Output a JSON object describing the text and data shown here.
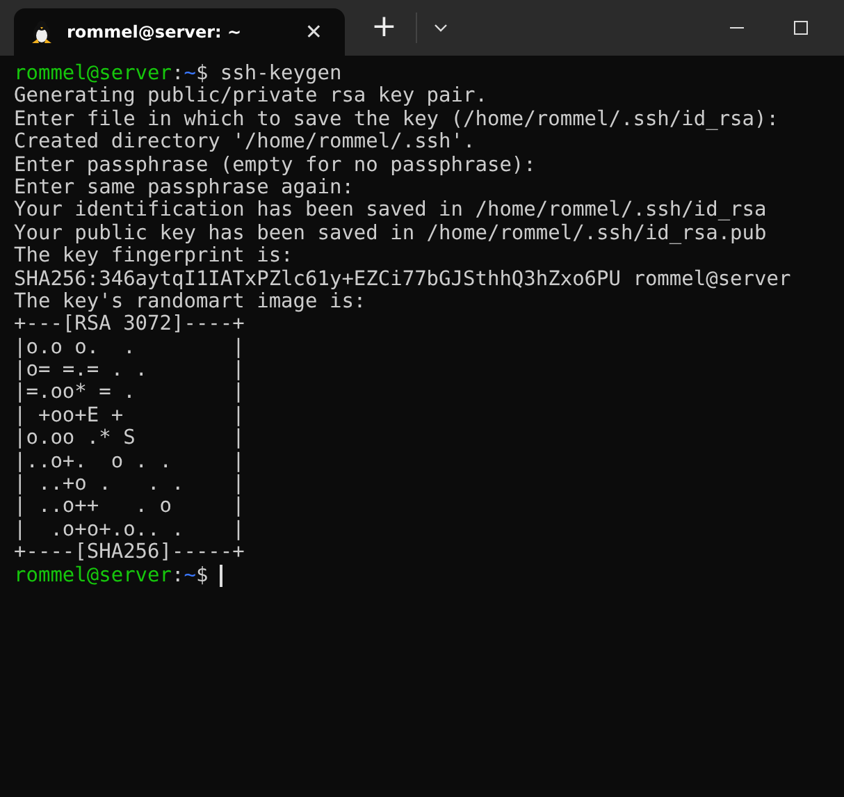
{
  "tab": {
    "title": "rommel@server: ~",
    "selected": true,
    "close": "✕"
  },
  "toolbar": {
    "new_tab": "+"
  },
  "lines": [
    {
      "kind": "prompt",
      "user_host": "rommel@server",
      "separator": ":",
      "path": "~",
      "symbol": "$",
      "command": "ssh-keygen",
      "cursor": false
    },
    {
      "kind": "output",
      "text": "Generating public/private rsa key pair."
    },
    {
      "kind": "output",
      "text": "Enter file in which to save the key (/home/rommel/.ssh/id_rsa):"
    },
    {
      "kind": "output",
      "text": "Created directory '/home/rommel/.ssh'."
    },
    {
      "kind": "output",
      "text": "Enter passphrase (empty for no passphrase):"
    },
    {
      "kind": "output",
      "text": "Enter same passphrase again:"
    },
    {
      "kind": "output",
      "text": "Your identification has been saved in /home/rommel/.ssh/id_rsa"
    },
    {
      "kind": "output",
      "text": "Your public key has been saved in /home/rommel/.ssh/id_rsa.pub"
    },
    {
      "kind": "output",
      "text": "The key fingerprint is:"
    },
    {
      "kind": "output",
      "text": "SHA256:346aytqI1IATxPZlc61y+EZCi77bGJSthhQ3hZxo6PU rommel@server"
    },
    {
      "kind": "output",
      "text": "The key's randomart image is:"
    },
    {
      "kind": "output",
      "text": "+---[RSA 3072]----+"
    },
    {
      "kind": "output",
      "text": "|o.o o.  .        |"
    },
    {
      "kind": "output",
      "text": "|o= =.= . .       |"
    },
    {
      "kind": "output",
      "text": "|=.oo* = .        |"
    },
    {
      "kind": "output",
      "text": "| +oo+E +         |"
    },
    {
      "kind": "output",
      "text": "|o.oo .* S        |"
    },
    {
      "kind": "output",
      "text": "|..o+.  o . .     |"
    },
    {
      "kind": "output",
      "text": "| ..+o .   . .    |"
    },
    {
      "kind": "output",
      "text": "| ..o++   . o     |"
    },
    {
      "kind": "output",
      "text": "|  .o+o+.o.. .    |"
    },
    {
      "kind": "output",
      "text": "+----[SHA256]-----+"
    },
    {
      "kind": "prompt",
      "user_host": "rommel@server",
      "separator": ":",
      "path": "~",
      "symbol": "$",
      "cursor": true
    }
  ]
}
